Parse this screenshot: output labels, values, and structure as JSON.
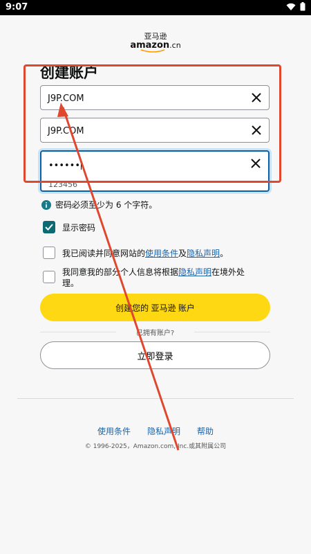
{
  "status_bar": {
    "time": "9:07"
  },
  "logo": {
    "cn": "亚马逊",
    "en": "amazon",
    "en_suffix": ".cn"
  },
  "page_title": "创建账户",
  "fields": [
    {
      "value": "J9P.COM"
    },
    {
      "value": "J9P.COM"
    },
    {
      "value": "••••••",
      "hint": "123456"
    }
  ],
  "password_info": "密码必须至少为 6 个字符。",
  "show_password": {
    "label": "显示密码",
    "checked": true
  },
  "agree_terms": {
    "prefix": "我已阅读并同意网站的",
    "link1": "使用条件",
    "mid": "及",
    "link2": "隐私声明",
    "suffix": "。"
  },
  "agree_transfer": {
    "prefix": "我同意我的部分个人信息将根据",
    "link": "隐私声明",
    "suffix": "在境外处理。"
  },
  "create_button": "创建您的 亚马逊 账户",
  "divider_text": "已拥有账户?",
  "sign_in_button": "立即登录",
  "footer": {
    "links": [
      "使用条件",
      "隐私声明",
      "帮助"
    ],
    "copyright": "© 1996-2025，Amazon.com, Inc.或其附属公司"
  },
  "colors": {
    "accent": "#ffd814",
    "link": "#1d64ab",
    "annotation": "#e0472e",
    "checkbox": "#0b6a72"
  },
  "icons": [
    "wifi-icon",
    "battery-icon",
    "clear-icon",
    "info-icon",
    "check-icon"
  ]
}
